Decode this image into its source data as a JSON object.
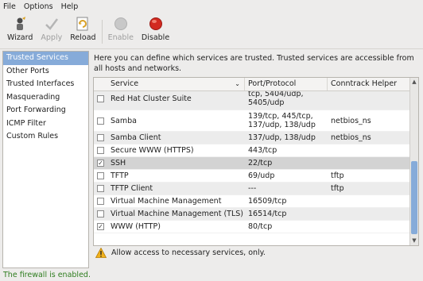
{
  "menu": {
    "file": "File",
    "options": "Options",
    "help": "Help"
  },
  "toolbar": {
    "wizard": "Wizard",
    "apply": "Apply",
    "reload": "Reload",
    "enable": "Enable",
    "disable": "Disable"
  },
  "sidebar": {
    "items": [
      {
        "label": "Trusted Services"
      },
      {
        "label": "Other Ports"
      },
      {
        "label": "Trusted Interfaces"
      },
      {
        "label": "Masquerading"
      },
      {
        "label": "Port Forwarding"
      },
      {
        "label": "ICMP Filter"
      },
      {
        "label": "Custom Rules"
      }
    ]
  },
  "main": {
    "description": "Here you can define which services are trusted. Trusted services are accessible from all hosts and networks.",
    "columns": {
      "service": "Service",
      "port": "Port/Protocol",
      "helper": "Conntrack Helper"
    },
    "rows": [
      {
        "checked": false,
        "service": "Red Hat Cluster Suite",
        "port_line1": "tcp, 5404/udp,",
        "port_line2": "5405/udp",
        "helper": ""
      },
      {
        "checked": false,
        "service": "Samba",
        "port_line1": "139/tcp, 445/tcp,",
        "port_line2": "137/udp, 138/udp",
        "helper": "netbios_ns"
      },
      {
        "checked": false,
        "service": "Samba Client",
        "port_line1": "137/udp, 138/udp",
        "port_line2": "",
        "helper": "netbios_ns"
      },
      {
        "checked": false,
        "service": "Secure WWW (HTTPS)",
        "port_line1": "443/tcp",
        "port_line2": "",
        "helper": ""
      },
      {
        "checked": true,
        "service": "SSH",
        "port_line1": "22/tcp",
        "port_line2": "",
        "helper": ""
      },
      {
        "checked": false,
        "service": "TFTP",
        "port_line1": "69/udp",
        "port_line2": "",
        "helper": "tftp"
      },
      {
        "checked": false,
        "service": "TFTP Client",
        "port_line1": "---",
        "port_line2": "",
        "helper": "tftp"
      },
      {
        "checked": false,
        "service": "Virtual Machine Management",
        "port_line1": "16509/tcp",
        "port_line2": "",
        "helper": ""
      },
      {
        "checked": false,
        "service": "Virtual Machine Management (TLS)",
        "port_line1": "16514/tcp",
        "port_line2": "",
        "helper": ""
      },
      {
        "checked": true,
        "service": "WWW (HTTP)",
        "port_line1": "80/tcp",
        "port_line2": "",
        "helper": ""
      }
    ],
    "hint": "Allow access to necessary services, only."
  },
  "status": "The firewall is enabled.",
  "colors": {
    "selection": "#86abd9",
    "status_green": "#2e7d1f",
    "disable_red": "#d22a20"
  }
}
